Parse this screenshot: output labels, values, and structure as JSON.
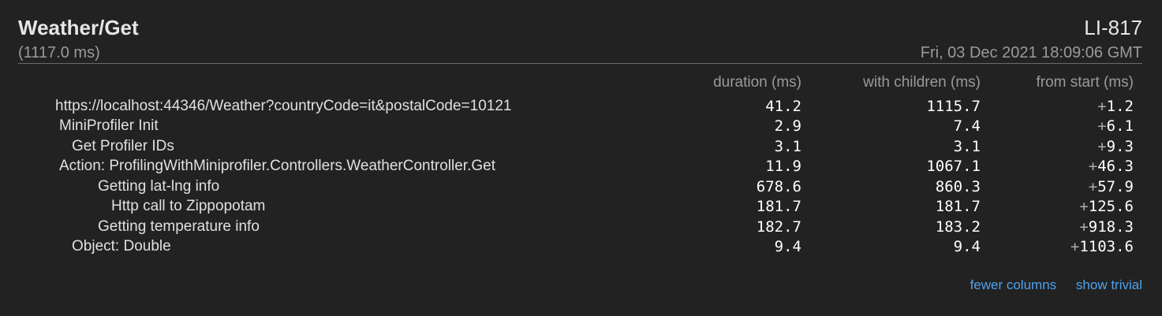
{
  "header": {
    "title": "Weather/Get",
    "duration": "(1117.0 ms)",
    "machine": "LI-817",
    "timestamp": "Fri, 03 Dec 2021 18:09:06 GMT"
  },
  "columns": {
    "duration": "duration (ms)",
    "with_children": "with children (ms)",
    "from_start": "from start (ms)"
  },
  "rows": [
    {
      "label": "https://localhost:44346/Weather?countryCode=it&postalCode=10121",
      "depth": 0,
      "duration": "41.2",
      "with_children": "1115.7",
      "from_start": "1.2"
    },
    {
      "label": "MiniProfiler Init",
      "depth": 1,
      "duration": "2.9",
      "with_children": "7.4",
      "from_start": "6.1"
    },
    {
      "label": "Get Profiler IDs",
      "depth": 2,
      "duration": "3.1",
      "with_children": "3.1",
      "from_start": "9.3"
    },
    {
      "label": "Action: ProfilingWithMiniprofiler.Controllers.WeatherController.Get",
      "depth": 1,
      "duration": "11.9",
      "with_children": "1067.1",
      "from_start": "46.3"
    },
    {
      "label": "Getting lat-lng info",
      "depth": 3,
      "duration": "678.6",
      "with_children": "860.3",
      "from_start": "57.9"
    },
    {
      "label": "Http call to Zippopotam",
      "depth": 4,
      "duration": "181.7",
      "with_children": "181.7",
      "from_start": "125.6"
    },
    {
      "label": "Getting temperature info",
      "depth": 3,
      "duration": "182.7",
      "with_children": "183.2",
      "from_start": "918.3"
    },
    {
      "label": "Object: Double",
      "depth": 2,
      "duration": "9.4",
      "with_children": "9.4",
      "from_start": "1103.6"
    }
  ],
  "footer": {
    "fewer_columns": "fewer columns",
    "show_trivial": "show trivial"
  },
  "colors": {
    "background": "#222222",
    "link": "#4ea2ee"
  }
}
